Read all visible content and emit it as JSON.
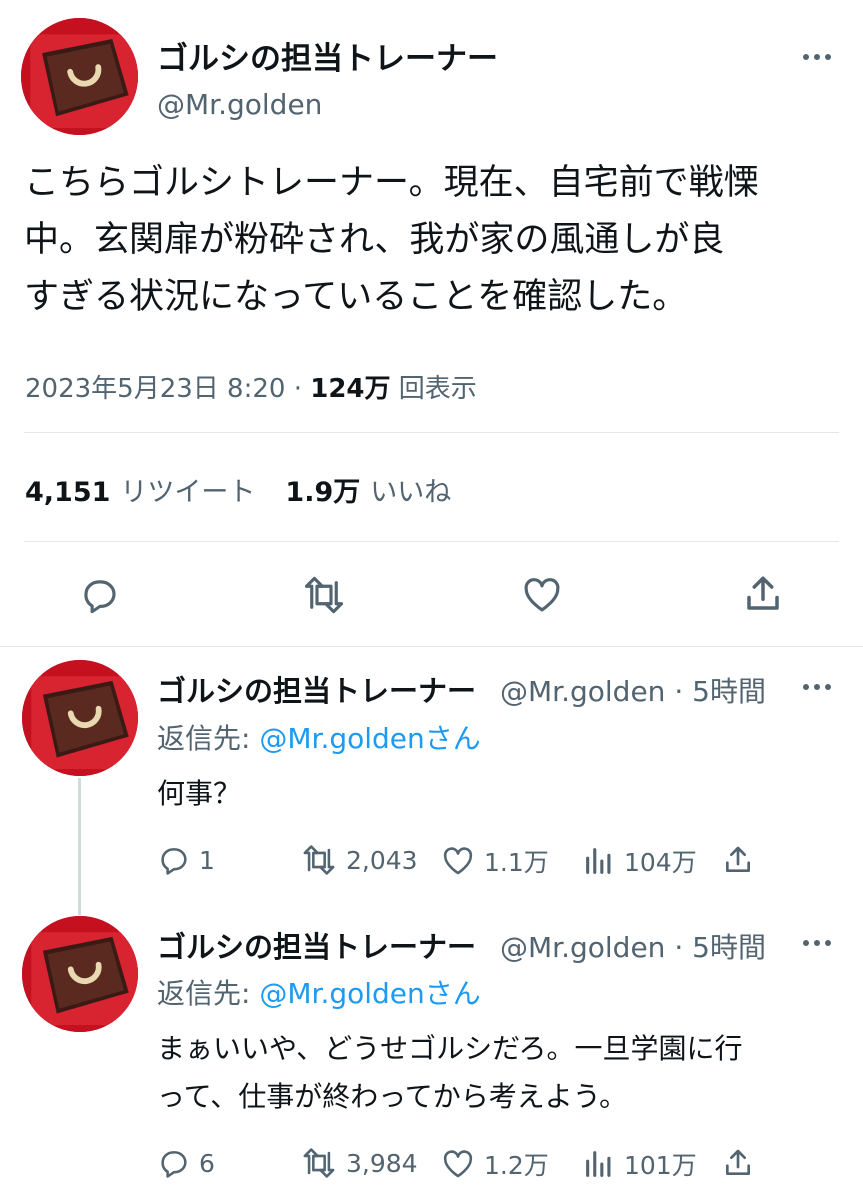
{
  "main_tweet": {
    "display_name": "ゴルシの担当トレーナー",
    "handle": "@Mr.golden",
    "text_lines": [
      "こちらゴルシトレーナー。現在、自宅前で戦慄",
      "中。玄関扉が粉砕され、我が家の風通しが良",
      "すぎる状況になっていることを確認した。"
    ],
    "timestamp": "2023年5月23日 8:20",
    "separator": " · ",
    "views_count": "124万",
    "views_label": " 回表示",
    "retweets_count": "4,151",
    "retweets_label": "リツイート",
    "likes_count": "1.9万",
    "likes_label": "いいね"
  },
  "replies": [
    {
      "display_name": "ゴルシの担当トレーナー",
      "handle_time": "@Mr.golden · 5時間",
      "reply_to_prefix": "返信先: ",
      "reply_to_mention": "@Mr.goldenさん",
      "text_lines": [
        "何事？"
      ],
      "reply_count": "1",
      "retweet_count": "2,043",
      "like_count": "1.1万",
      "view_count": "104万"
    },
    {
      "display_name": "ゴルシの担当トレーナー",
      "handle_time": "@Mr.golden · 5時間",
      "reply_to_prefix": "返信先: ",
      "reply_to_mention": "@Mr.goldenさん",
      "text_lines": [
        "まぁいいや、どうせゴルシだろ。一旦学園に行",
        "って、仕事が終わってから考えよう。"
      ],
      "reply_count": "6",
      "retweet_count": "3,984",
      "like_count": "1.2万",
      "view_count": "101万"
    }
  ],
  "colors": {
    "text": "#0f1419",
    "secondary": "#536471",
    "link": "#1d9bf0",
    "divider": "#e4e7ea",
    "avatar_bg": "#c5101f"
  }
}
